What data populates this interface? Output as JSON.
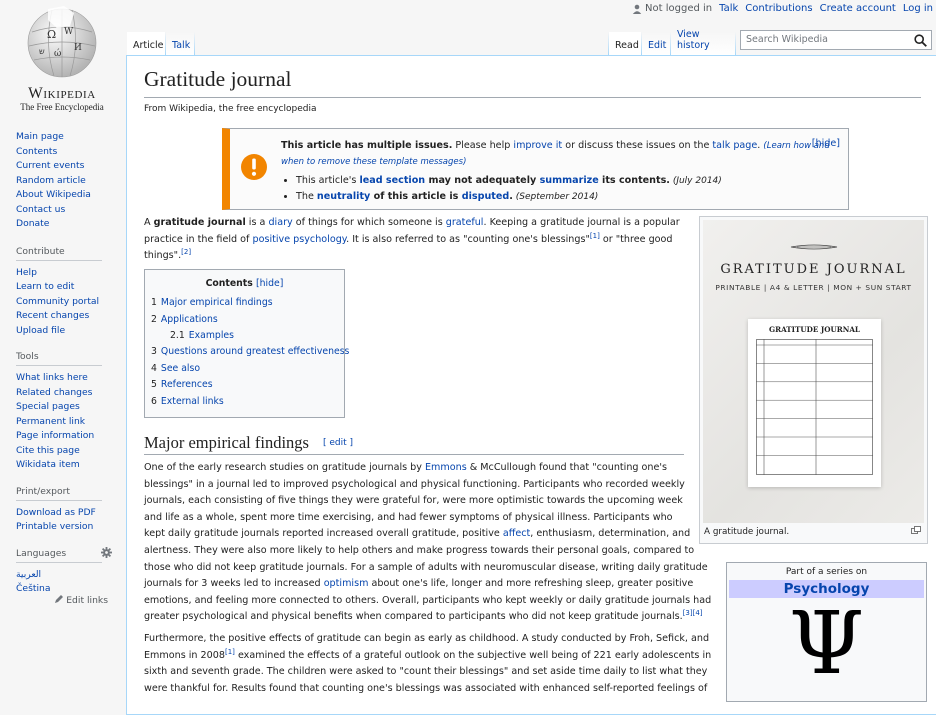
{
  "personal": {
    "not_logged": "Not logged in",
    "items": [
      "Talk",
      "Contributions",
      "Create account",
      "Log in"
    ]
  },
  "logo": {
    "wordmark": "Wikipedia",
    "tagline": "The Free Encyclopedia"
  },
  "sidebar": {
    "nav": [
      "Main page",
      "Contents",
      "Current events",
      "Random article",
      "About Wikipedia",
      "Contact us",
      "Donate"
    ],
    "contribute_heading": "Contribute",
    "contribute": [
      "Help",
      "Learn to edit",
      "Community portal",
      "Recent changes",
      "Upload file"
    ],
    "tools_heading": "Tools",
    "tools": [
      "What links here",
      "Related changes",
      "Special pages",
      "Permanent link",
      "Page information",
      "Cite this page",
      "Wikidata item"
    ],
    "print_heading": "Print/export",
    "print": [
      "Download as PDF",
      "Printable version"
    ],
    "languages_heading": "Languages",
    "languages": [
      "العربية",
      "Čeština"
    ],
    "edit_links": "Edit links"
  },
  "tabs": {
    "article": "Article",
    "talk": "Talk",
    "read": "Read",
    "edit": "Edit",
    "history": "View history"
  },
  "search": {
    "placeholder": "Search Wikipedia"
  },
  "page": {
    "title": "Gratitude journal",
    "from": "From Wikipedia, the free encyclopedia"
  },
  "ambox": {
    "hide": "[hide]",
    "line1_bold": "This article has multiple issues.",
    "line1_a": " Please help ",
    "improve": "improve it",
    "line1_b": " or discuss these issues on the ",
    "talk_page": "talk page",
    "line1_c": ". ",
    "learn": "(Learn how and when to remove these template messages)",
    "i1_a": "This article's ",
    "i1_lead": "lead section",
    "i1_b": " may not adequately ",
    "i1_sum": "summarize",
    "i1_c": " its contents.",
    "i1_date": " (July 2014)",
    "i2_a": "The ",
    "i2_neu": "neutrality",
    "i2_b": " of this article is ",
    "i2_disp": "disputed",
    "i2_c": ".",
    "i2_date": " (September 2014)"
  },
  "intro": {
    "a": "A ",
    "bold": "gratitude journal",
    "b": " is a ",
    "diary": "diary",
    "c": " of things for which someone is ",
    "grateful": "grateful",
    "d": ". Keeping a gratitude journal is a popular practice in the field of ",
    "pp": "positive psychology",
    "e": ". It is also referred to as \"counting one's blessings\"",
    "ref1": "[1]",
    "f": " or \"three good things\".",
    "ref2": "[2]"
  },
  "toc": {
    "title": "Contents",
    "hide": "[hide]",
    "items": [
      {
        "num": "1",
        "label": "Major empirical findings"
      },
      {
        "num": "2",
        "label": "Applications"
      },
      {
        "num": "2.1",
        "label": "Examples"
      },
      {
        "num": "3",
        "label": "Questions around greatest effectiveness"
      },
      {
        "num": "4",
        "label": "See also"
      },
      {
        "num": "5",
        "label": "References"
      },
      {
        "num": "6",
        "label": "External links"
      }
    ]
  },
  "section1": {
    "title": "Major empirical findings",
    "edit": "[ edit ]"
  },
  "para1": [
    [
      "One of the early research studies on gratitude journals by ",
      "Emmons",
      " & McCullough found that \"counting one's"
    ],
    [
      "blessings\" in a journal led to improved psychological and physical functioning. Participants who recorded weekly"
    ],
    [
      "journals, each consisting of five things they were grateful for, were more optimistic towards the upcoming week"
    ],
    [
      "and life as a whole, spent more time exercising, and had fewer symptoms of physical illness. Participants who"
    ],
    [
      "kept daily gratitude journals reported increased overall gratitude, positive ",
      "affect",
      ", enthusiasm, determination, and"
    ],
    [
      "alertness. They were also more likely to help others and make progress towards their personal goals, compared to"
    ],
    [
      "those who did not keep gratitude journals. For a sample of adults with neuromuscular disease, writing daily gratitude"
    ],
    [
      "journals for 3 weeks led to increased ",
      "optimism",
      " about one's life, longer and more refreshing sleep, greater positive"
    ],
    [
      "emotions, and feeling more connected to others. Overall, participants who kept weekly or daily gratitude journals had"
    ],
    [
      "greater psychological and physical benefits when compared to participants who did not keep gratitude journals.",
      "[3][4]"
    ]
  ],
  "para2": [
    [
      "Furthermore, the positive effects of gratitude can begin as early as childhood. A study conducted by Froh, Sefick, and"
    ],
    [
      "Emmons in 2008",
      "[1]",
      " examined the effects of a grateful outlook on the subjective well being of 221 early adolescents in"
    ],
    [
      "sixth and seventh grade. The children were asked to \"count their blessings\" and set aside time daily to list what they"
    ],
    [
      "were thankful for. Results found that counting one's blessings was associated with enhanced self-reported feelings of"
    ]
  ],
  "thumb": {
    "caption": "A gratitude journal.",
    "img_title": "GRATITUDE JOURNAL",
    "img_sub": "PRINTABLE | A4 & LETTER | MON + SUN START",
    "sheet_title": "GRATITUDE JOURNAL"
  },
  "psy": {
    "pre": "Part of a series on",
    "title": "Psychology",
    "symbol": "Ψ"
  }
}
